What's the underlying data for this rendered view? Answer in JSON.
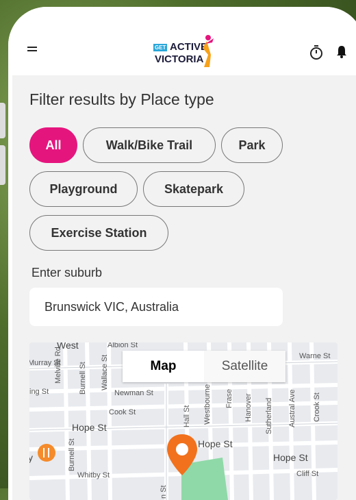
{
  "header": {
    "logo": {
      "get": "GET",
      "active": "ACTIVE",
      "victoria": "VICTORIA"
    },
    "icons": [
      "menu-icon",
      "stopwatch-icon",
      "bell-icon"
    ]
  },
  "filter": {
    "title": "Filter results by Place type",
    "chips": [
      "All",
      "Walk/Bike Trail",
      "Park",
      "Playground",
      "Skatepark",
      "Exercise Station"
    ],
    "selected": "All"
  },
  "suburb": {
    "label": "Enter suburb",
    "value": "Brunswick VIC, Australia"
  },
  "map": {
    "toggle": {
      "map": "Map",
      "satellite": "Satellite",
      "selected": "Map"
    },
    "streets": {
      "west": "West",
      "albion": "Albion St",
      "murray": "Murray St",
      "melville": "Melville Rd",
      "burnell": "Burnell St",
      "wallace": "Wallace St",
      "warne": "Warne St",
      "ing": "ing St",
      "newman": "Newman St",
      "cook": "Cook St",
      "hope_left": "Hope St",
      "hope_mid": "Hope St",
      "hope_right": "Hope St",
      "burnell2": "Burnell St",
      "whitby": "Whitby St",
      "cliff": "Cliff St",
      "hall": "Hall St",
      "westbourne": "Westbourne",
      "fraser": "Frase",
      "hanover": "Hanover",
      "sutherland": "Sutherland",
      "austral": "Austral Ave",
      "crook": "Crook St",
      "y": "y",
      "n": "n St"
    },
    "colors": {
      "pin": "#f2711c",
      "park": "#8fd9a8",
      "food_pin": "#f58b2a"
    }
  },
  "colors": {
    "accent": "#e5157e"
  }
}
